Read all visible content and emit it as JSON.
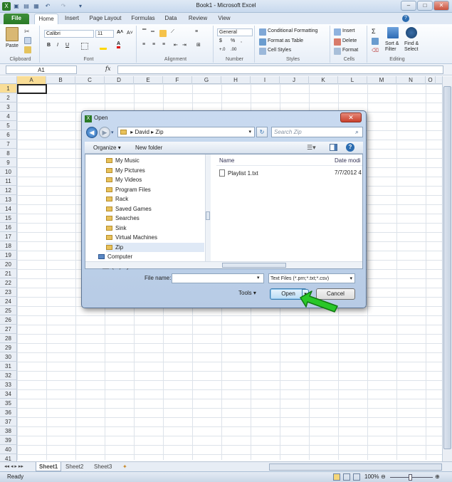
{
  "app": {
    "title": "Book1 - Microsoft Excel"
  },
  "tabs": [
    {
      "label": "File"
    },
    {
      "label": "Home"
    },
    {
      "label": "Insert"
    },
    {
      "label": "Page Layout"
    },
    {
      "label": "Formulas"
    },
    {
      "label": "Data"
    },
    {
      "label": "Review"
    },
    {
      "label": "View"
    }
  ],
  "ribbon": {
    "clipboard": {
      "paste": "Paste",
      "label": "Clipboard"
    },
    "font": {
      "name": "Calibri",
      "size": "11",
      "label": "Font"
    },
    "alignment": {
      "label": "Alignment"
    },
    "number": {
      "format": "General",
      "dollar": "$",
      "percent": "%",
      "comma": ",",
      "label": "Number"
    },
    "styles": {
      "cond": "Conditional Formatting",
      "table": "Format as Table",
      "cell": "Cell Styles",
      "label": "Styles"
    },
    "cells": {
      "insert": "Insert",
      "delete": "Delete",
      "format": "Format",
      "label": "Cells"
    },
    "editing": {
      "sort": "Sort &",
      "sort2": "Filter",
      "find": "Find &",
      "find2": "Select",
      "label": "Editing"
    }
  },
  "formula": {
    "namebox": "A1",
    "fx": "fx",
    "value": ""
  },
  "columns": [
    "A",
    "B",
    "C",
    "D",
    "E",
    "F",
    "G",
    "H",
    "I",
    "J",
    "K",
    "L",
    "M",
    "N",
    "O"
  ],
  "rows": [
    "1",
    "2",
    "3",
    "4",
    "5",
    "6",
    "7",
    "8",
    "9",
    "10",
    "11",
    "12",
    "13",
    "14",
    "15",
    "16",
    "17",
    "18",
    "19",
    "20",
    "21",
    "22",
    "23",
    "24",
    "25",
    "26",
    "27",
    "28",
    "29",
    "30",
    "31",
    "32",
    "33",
    "34",
    "35",
    "36",
    "37",
    "38",
    "39",
    "40",
    "41"
  ],
  "sheets": [
    "Sheet1",
    "Sheet2",
    "Sheet3"
  ],
  "status": {
    "ready": "Ready",
    "zoom": "100%"
  },
  "dialog": {
    "title": "Open",
    "breadcrumb": [
      "David",
      "Zip"
    ],
    "search_placeholder": "Search Zip",
    "organize": "Organize",
    "new_folder": "New folder",
    "nav_items": [
      "My Music",
      "My Pictures",
      "My Videos",
      "Program Files",
      "Rack",
      "Saved Games",
      "Searches",
      "Sink",
      "Virtual Machines",
      "Zip",
      "Computer",
      "(C:) System"
    ],
    "columns": {
      "name": "Name",
      "date": "Date modi"
    },
    "files": [
      {
        "name": "Playlist 1.txt",
        "date": "7/7/2012 4"
      }
    ],
    "filename_label": "File name:",
    "filename_value": "",
    "filter": "Text Files (*.prn;*.txt;*.csv)",
    "tools": "Tools",
    "open": "Open",
    "cancel": "Cancel"
  },
  "colors": {
    "file_tab": "#2a7a26",
    "dialog_bg": "#c0d3ec",
    "arrow": "#29c729"
  }
}
